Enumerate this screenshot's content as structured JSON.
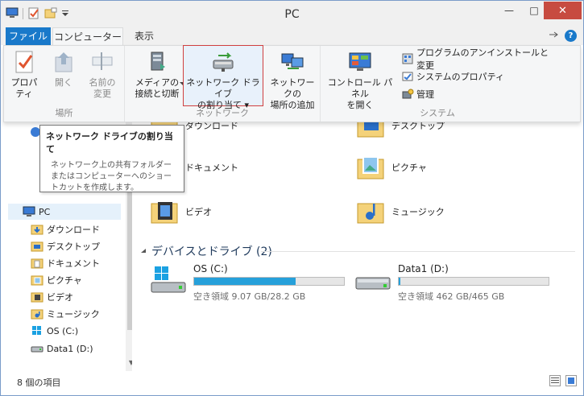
{
  "window": {
    "title": "PC",
    "minimize": "—",
    "maximize": "□",
    "close": "✕"
  },
  "tabs": {
    "file": "ファイル",
    "computer": "コンピューター",
    "view": "表示",
    "help": "?"
  },
  "ribbon": {
    "location_group": {
      "label": "場所",
      "properties": "プロパティ",
      "open": "開く",
      "rename_line1": "名前の",
      "rename_line2": "変更"
    },
    "network_group": {
      "label": "ネットワーク",
      "media_line1": "メディアの",
      "media_line2": "接続と切断",
      "map_drive_line1": "ネットワーク ドライブ",
      "map_drive_line2": "の割り当て",
      "add_location_line1": "ネットワークの",
      "add_location_line2": "場所の追加"
    },
    "system_group": {
      "label": "システム",
      "control_panel_line1": "コントロール パネル",
      "control_panel_line2": "を開く",
      "uninstall": "プログラムのアンインストールと変更",
      "system_props": "システムのプロパティ",
      "manage": "管理"
    }
  },
  "tooltip": {
    "title": "ネットワーク ドライブの割り当て",
    "body": "ネットワーク上の共有フォルダーまたはコンピューターへのショートカットを作成します。"
  },
  "nav": {
    "items": [
      {
        "label": "PC"
      },
      {
        "label": "ダウンロード"
      },
      {
        "label": "デスクトップ"
      },
      {
        "label": "ドキュメント"
      },
      {
        "label": "ピクチャ"
      },
      {
        "label": "ビデオ"
      },
      {
        "label": "ミュージック"
      },
      {
        "label": "OS (C:)"
      },
      {
        "label": "Data1 (D:)"
      }
    ]
  },
  "content": {
    "folders": [
      {
        "label": "ダウンロード"
      },
      {
        "label": "デスクトップ"
      },
      {
        "label": "ドキュメント"
      },
      {
        "label": "ピクチャ"
      },
      {
        "label": "ビデオ"
      },
      {
        "label": "ミュージック"
      }
    ],
    "devices_heading": "デバイスとドライブ (2)",
    "drives": [
      {
        "name": "OS (C:)",
        "free": "空き領域 9.07 GB/28.2 GB",
        "used_fraction": 0.68
      },
      {
        "name": "Data1 (D:)",
        "free": "空き領域 462 GB/465 GB",
        "used_fraction": 0.006
      }
    ]
  },
  "status": {
    "items_count": "8 個の項目"
  },
  "colors": {
    "accent": "#1979ca",
    "drive_bar": "#26a0da",
    "close": "#c74b40",
    "selection_border": "#d04040"
  }
}
